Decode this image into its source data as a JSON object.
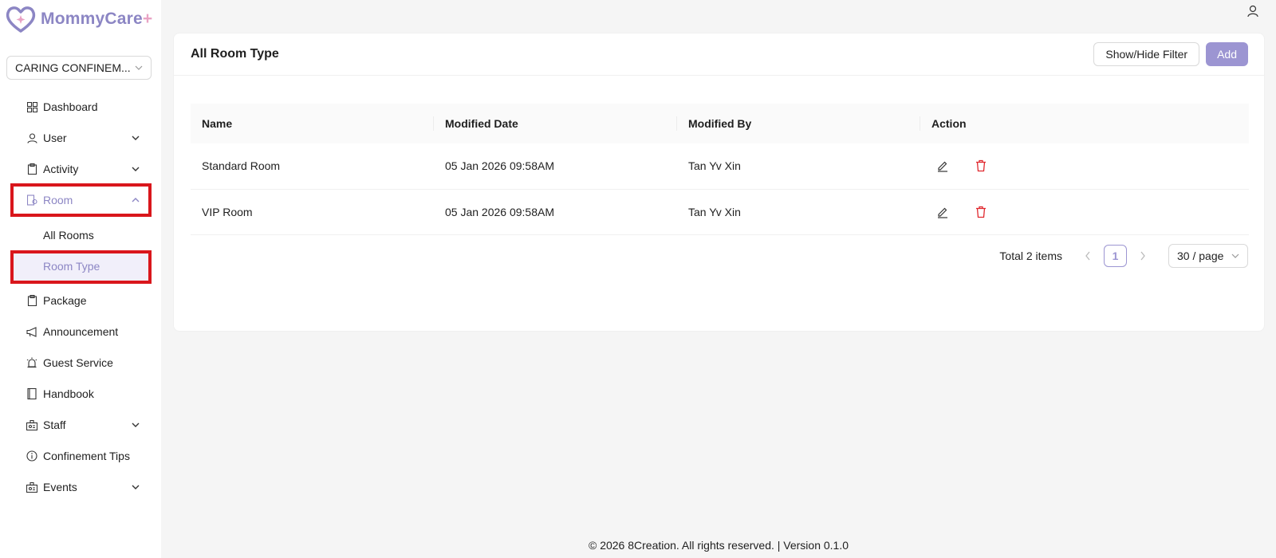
{
  "brand": {
    "name": "MommyCare",
    "plus": "+",
    "accent": "#8c86c4",
    "heart_color": "#8c86c4"
  },
  "org_select": {
    "value": "CARING CONFINEM..."
  },
  "sidebar": {
    "items": [
      {
        "label": "Dashboard",
        "icon": "dashboard-icon"
      },
      {
        "label": "User",
        "icon": "user-icon",
        "expandable": true
      },
      {
        "label": "Activity",
        "icon": "clipboard-icon",
        "expandable": true
      },
      {
        "label": "Room",
        "icon": "room-icon",
        "expandable": true,
        "expanded": true,
        "children": [
          {
            "label": "All Rooms"
          },
          {
            "label": "Room Type",
            "selected": true
          }
        ]
      },
      {
        "label": "Package",
        "icon": "clipboard-icon"
      },
      {
        "label": "Announcement",
        "icon": "megaphone-icon"
      },
      {
        "label": "Guest Service",
        "icon": "alarm-icon"
      },
      {
        "label": "Handbook",
        "icon": "book-icon"
      },
      {
        "label": "Staff",
        "icon": "badge-icon",
        "expandable": true
      },
      {
        "label": "Confinement Tips",
        "icon": "info-icon"
      },
      {
        "label": "Events",
        "icon": "badge-icon",
        "expandable": true
      }
    ]
  },
  "page": {
    "title": "All Room Type",
    "show_hide_filter": "Show/Hide Filter",
    "add": "Add"
  },
  "table": {
    "columns": [
      "Name",
      "Modified Date",
      "Modified By",
      "Action"
    ],
    "rows": [
      {
        "name": "Standard Room",
        "modified_date": "05 Jan 2026 09:58AM",
        "modified_by": "Tan Yv Xin"
      },
      {
        "name": "VIP Room",
        "modified_date": "05 Jan 2026 09:58AM",
        "modified_by": "Tan Yv Xin"
      }
    ]
  },
  "pagination": {
    "total": "Total 2 items",
    "current_page": "1",
    "page_size": "30 / page"
  },
  "footer": "© 2026 8Creation. All rights reserved. | Version 0.1.0",
  "colors": {
    "highlight_box": "#d9161c",
    "delete": "#e0282e",
    "primary": "#9c95d2"
  }
}
